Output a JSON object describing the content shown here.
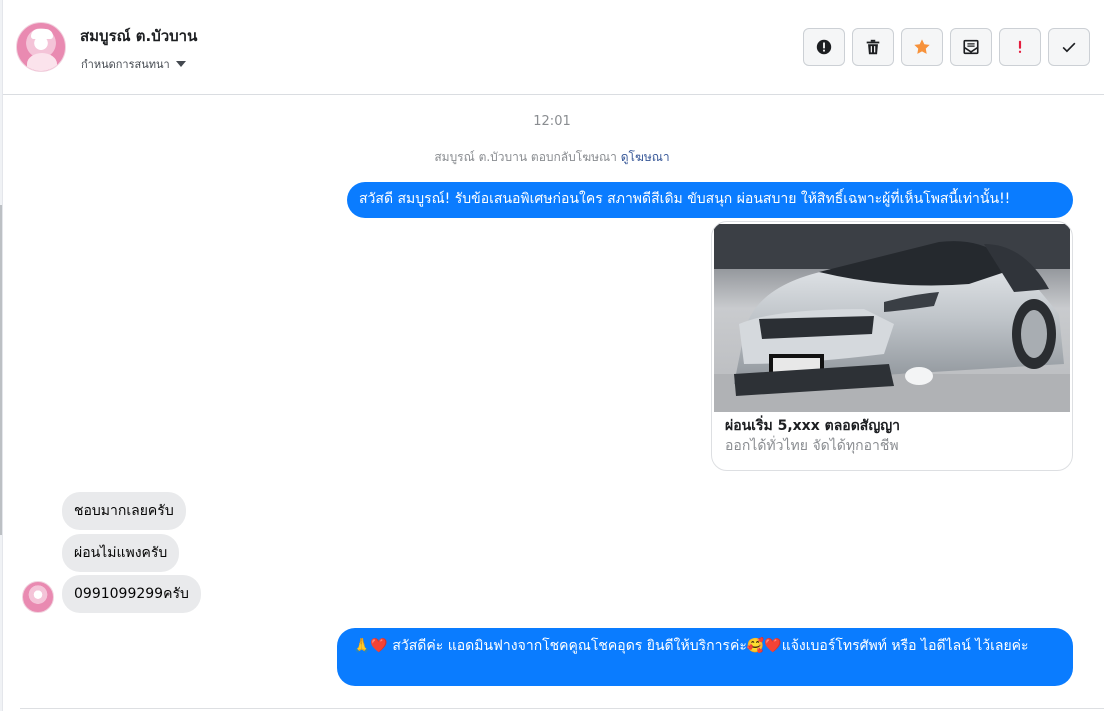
{
  "header": {
    "contact_name": "สมบูรณ์ ต.บัวบาน",
    "sub_label": "กำหนดการสนทนา",
    "actions": [
      "report-icon",
      "trash-icon",
      "star-icon",
      "mail-icon",
      "exclamation-icon",
      "check-icon"
    ]
  },
  "thread": {
    "timestamp": "12:01",
    "ad_reply_note": "สมบูรณ์ ต.บัวบาน ตอบกลับโฆษณา",
    "ad_link": "ดูโฆษณา",
    "outgoing_1": "สวัสดี สมบูรณ์! รับข้อเสนอพิเศษก่อนใคร สภาพดีสีเดิม ขับสนุก ผ่อนสบาย ให้สิทธิ์เฉพาะผู้ที่เห็นโพสนี้เท่านั้น!!",
    "card": {
      "title": "ผ่อนเริ่ม 5,xxx ตลอดสัญญา",
      "subtitle": "ออกได้ทั่วไทย จัดได้ทุกอาชีพ"
    },
    "incoming": [
      "ชอบมากเลยครับ",
      "ผ่อนไม่แพงครับ",
      "0991099299ครับ"
    ],
    "outgoing_2": "🙏❤️ สวัสดีค่ะ แอดมินฟางจากโชคคูณโชคอุดร ยินดีให้บริการค่ะ🥰❤️แจ้งเบอร์โทรศัพท์ หรือ ไอดีไลน์  ไว้เลยค่ะ"
  },
  "colors": {
    "outgoing_bubble": "#0a7cff",
    "incoming_bubble": "#e9eaec",
    "star": "#f7923b",
    "exclamation": "#e41e3f"
  }
}
